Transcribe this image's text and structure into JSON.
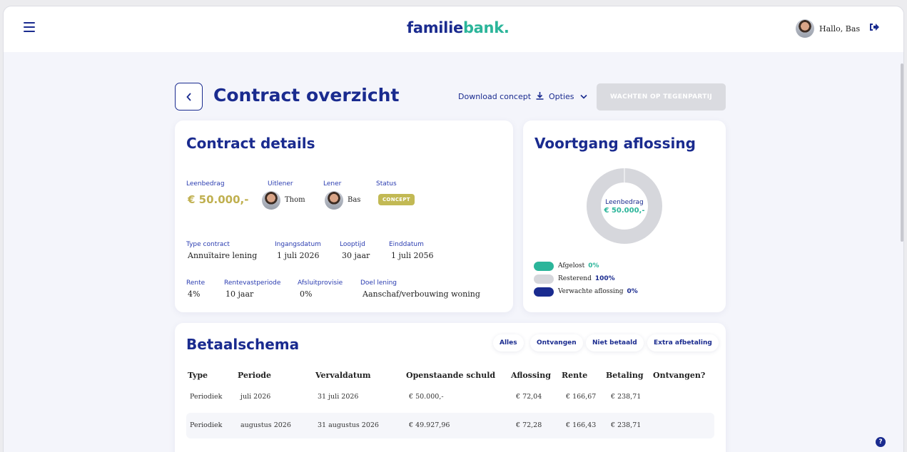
{
  "header": {
    "logo_part1": "familie",
    "logo_part2": "bank.",
    "greeting": "Hallo, Bas"
  },
  "page": {
    "title": "Contract overzicht",
    "download_label": "Download concept",
    "options_label": "Opties",
    "status_button": "WACHTEN OP TEGENPARTIJ"
  },
  "details": {
    "title": "Contract details",
    "leenbedrag_label": "Leenbedrag",
    "leenbedrag_value": "€ 50.000,-",
    "uitlener_label": "Uitlener",
    "uitlener_name": "Thom",
    "lener_label": "Lener",
    "lener_name": "Bas",
    "status_label": "Status",
    "status_value": "CONCEPT",
    "type_label": "Type contract",
    "type_value": "Annuïtaire lening",
    "ingang_label": "Ingangsdatum",
    "ingang_value": "1 juli 2026",
    "looptijd_label": "Looptijd",
    "looptijd_value": "30 jaar",
    "eind_label": "Einddatum",
    "eind_value": "1 juli 2056",
    "rente_label": "Rente",
    "rente_value": "4%",
    "rentevast_label": "Rentevastperiode",
    "rentevast_value": "10 jaar",
    "afsluit_label": "Afsluitprovisie",
    "afsluit_value": "0%",
    "doel_label": "Doel lening",
    "doel_value": "Aanschaf/verbouwing woning"
  },
  "voortgang": {
    "title": "Voortgang aflossing",
    "donut_label": "Leenbedrag",
    "donut_amount": "€ 50.000,-",
    "legend": [
      {
        "label": "Afgelost",
        "pct": "0%",
        "color": "#2bb59a"
      },
      {
        "label": "Resterend",
        "pct": "100%",
        "color": "#d6d7dc"
      },
      {
        "label": "Verwachte aflossing",
        "pct": "0%",
        "color": "#1a2b8f"
      }
    ]
  },
  "schema": {
    "title": "Betaalschema",
    "filters": [
      "Alles",
      "Ontvangen",
      "Niet betaald",
      "Extra afbetaling"
    ],
    "columns": [
      "Type",
      "Periode",
      "Vervaldatum",
      "Openstaande schuld",
      "Aflossing",
      "Rente",
      "Betaling",
      "Ontvangen?"
    ],
    "rows": [
      [
        "Periodiek",
        "juli 2026",
        "31 juli 2026",
        "€ 50.000,-",
        "€ 72,04",
        "€ 166,67",
        "€ 238,71",
        ""
      ],
      [
        "Periodiek",
        "augustus 2026",
        "31 augustus 2026",
        "€ 49.927,96",
        "€ 72,28",
        "€ 166,43",
        "€ 238,71",
        ""
      ]
    ]
  },
  "colors": {
    "brand_blue": "#1a2b8f",
    "brand_green": "#2bb59a",
    "concept_badge": "#c2b954",
    "amount": "#c0b050"
  }
}
